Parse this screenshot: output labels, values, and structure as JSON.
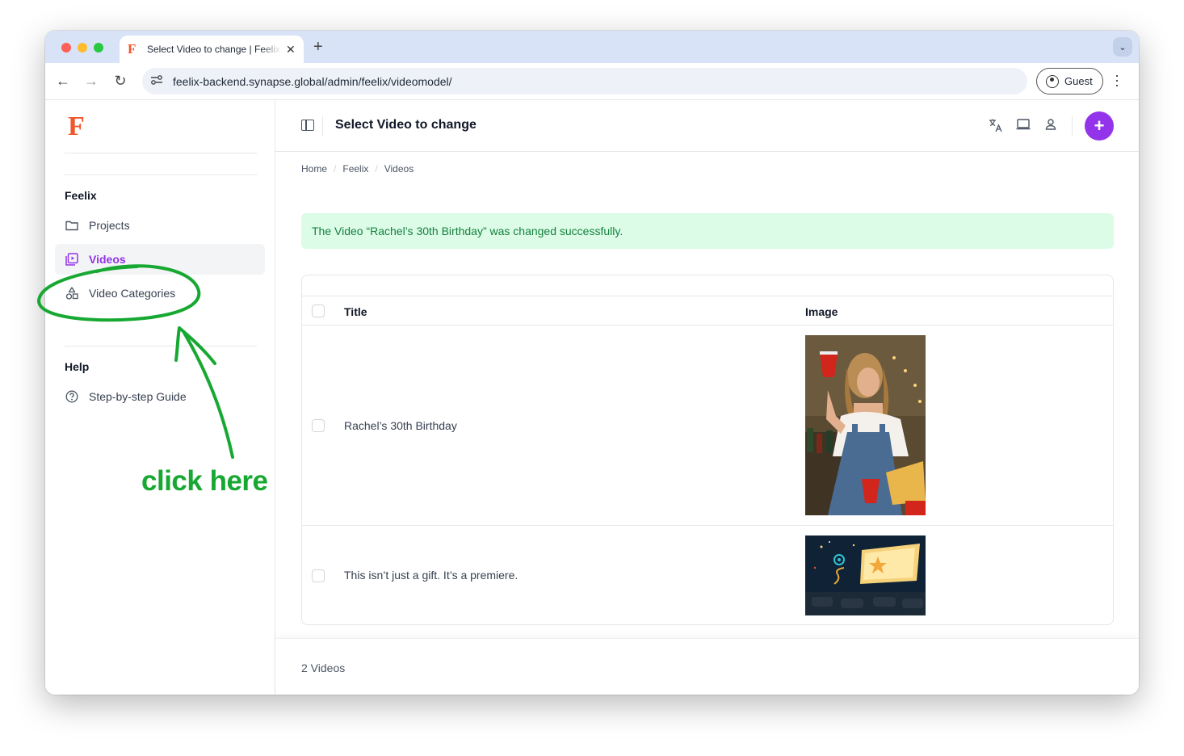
{
  "browser": {
    "tab_title": "Select Video to change | Feelix",
    "tab_favicon": "F",
    "new_tab": "+",
    "url": "feelix-backend.synapse.global/admin/feelix/videomodel/",
    "profile_label": "Guest"
  },
  "sidebar": {
    "brand": "F",
    "sections": [
      {
        "heading": "Feelix",
        "items": [
          {
            "label": "Projects",
            "icon": "folder-icon",
            "active": false
          },
          {
            "label": "Videos",
            "icon": "video-library-icon",
            "active": true
          },
          {
            "label": "Video Categories",
            "icon": "category-shapes-icon",
            "active": false
          }
        ]
      },
      {
        "heading": "Help",
        "items": [
          {
            "label": "Step-by-step Guide",
            "icon": "help-circle-icon",
            "active": false
          }
        ]
      }
    ]
  },
  "header": {
    "title": "Select Video to change",
    "add_label": "+"
  },
  "breadcrumb": [
    "Home",
    "Feelix",
    "Videos"
  ],
  "alert": {
    "message": "The Video “Rachel’s 30th Birthday” was changed successfully."
  },
  "table": {
    "columns": [
      "Title",
      "Image"
    ],
    "rows": [
      {
        "title": "Rachel’s 30th Birthday",
        "image": "party-photo-thumbnail"
      },
      {
        "title": "This isn’t just a gift. It’s a premiere.",
        "image": "drive-in-cinema-thumbnail"
      }
    ]
  },
  "footer": {
    "count": "2 Videos"
  },
  "annotation": {
    "text": "click here"
  },
  "colors": {
    "accent": "#9333ea",
    "brand": "#f1572c",
    "success_bg": "#dcfce7",
    "success_text": "#15803d",
    "annotation": "#17a832"
  }
}
